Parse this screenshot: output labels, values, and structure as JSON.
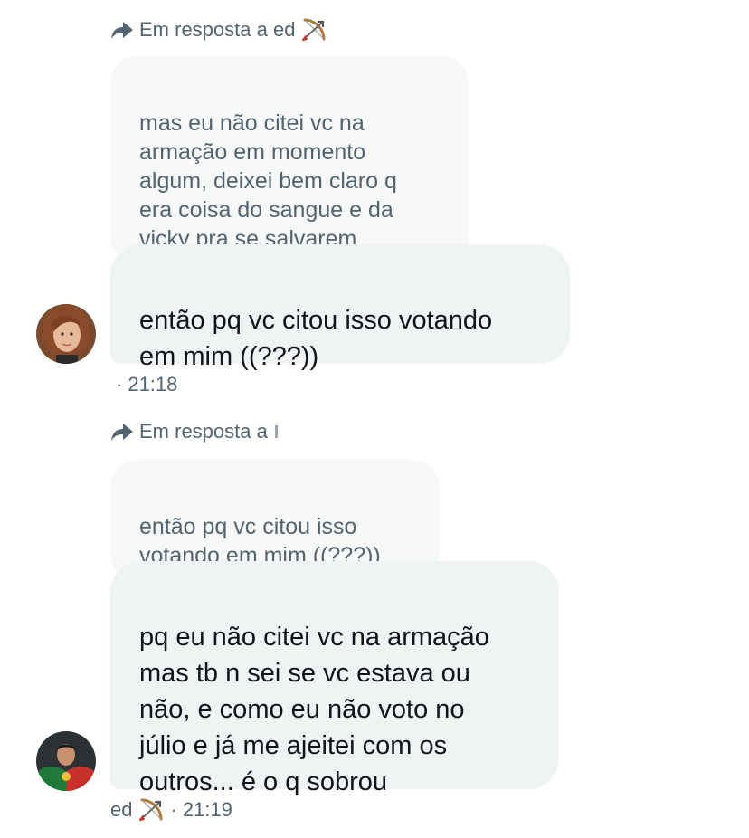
{
  "messages": [
    {
      "reply_to": {
        "prefix": "Em resposta a ed",
        "emoji": "bow-and-arrow-icon"
      },
      "quoted_text": "mas eu não citei vc na\narmação em momento\nalgum, deixei bem claro q\nera coisa do sangue e da\nvicky pra se salvarem",
      "text": "então pq vc citou isso votando\nem mim ((???))",
      "meta": {
        "sep": "·",
        "time": "21:18"
      }
    },
    {
      "reply_to": {
        "prefix": "Em resposta a"
      },
      "quoted_text": "então pq vc citou isso\nvotando em mim ((???))",
      "text": "pq eu não citei vc na armação\nmas tb n sei se vc estava ou\nnão, e como eu não voto no\njúlio e já me ajeitei com os\noutros... é o q sobrou",
      "meta": {
        "sender": "ed",
        "emoji": "bow-and-arrow-icon",
        "sep": "·",
        "time": "21:19"
      }
    }
  ],
  "colors": {
    "bubble": "#eff3f4",
    "quoted": "#f7f9f9",
    "secondary_text": "#536471",
    "primary_text": "#0f1419"
  }
}
